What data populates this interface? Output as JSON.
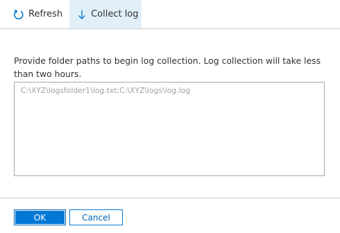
{
  "toolbar": {
    "refresh_label": "Refresh",
    "refresh_icon": "refresh-icon",
    "collect_label": "Collect log",
    "collect_icon": "download-arrow-icon"
  },
  "form": {
    "description": "Provide folder paths to begin log collection. Log collection will take less than two hours.",
    "paths_value": "",
    "paths_placeholder": "C:\\XYZ\\logsfolder1\\log.txt;C:\\XYZ\\logs\\log.log"
  },
  "actions": {
    "ok_label": "OK",
    "cancel_label": "Cancel"
  },
  "colors": {
    "accent": "#0078d4",
    "selected_tab_bg": "#e1eff9",
    "placeholder_text": "#a0a0a0"
  }
}
